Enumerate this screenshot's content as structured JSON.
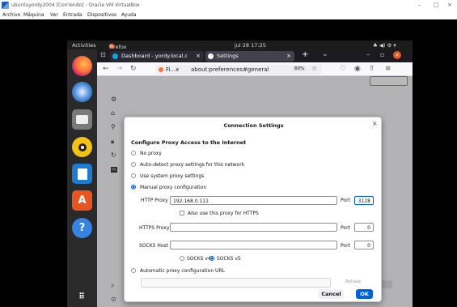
{
  "host": {
    "window_title": "ubuntuyordy2004 [Corriendo] - Oracle VM VirtualBox",
    "menu": [
      "Archivo",
      "Máquina",
      "Ver",
      "Entrada",
      "Dispositivos",
      "Ayuda"
    ],
    "controls": {
      "minimize": "–",
      "maximize": "□",
      "close": "×"
    }
  },
  "ubuntu": {
    "activities": "Activities",
    "app_name": "Firefox Web Browser ▾",
    "clock": "jul 28  17:25",
    "tray": "♣ ◀) ⚙ ▾",
    "dock_icons": [
      "firefox-icon",
      "thunderbird-icon",
      "files-icon",
      "rhythmbox-icon",
      "writer-icon",
      "software-icon",
      "help-icon",
      "apps-grid-icon"
    ]
  },
  "firefox": {
    "tabs": [
      {
        "label": "Dashboard - yordy.local.c",
        "close": "×"
      },
      {
        "label": "Settings",
        "close": "×"
      }
    ],
    "new_tab": "+",
    "list_tabs": "⌄",
    "window_min": "–",
    "window_max": "▫",
    "window_close": "×",
    "url_site": "Fi...x",
    "url": "about:preferences#general",
    "zoom": "80%"
  },
  "dialog": {
    "title": "Connection Settings",
    "close": "×",
    "heading": "Configure Proxy Access to the Internet",
    "options": {
      "no_proxy": "No proxy",
      "auto_detect": "Auto-detect proxy settings for this network",
      "system": "Use system proxy settings",
      "manual": "Manual proxy configuration",
      "auto_url": "Automatic proxy configuration URL"
    },
    "selected": "manual",
    "http_proxy_label": "HTTP Proxy",
    "http_proxy_value": "192.168.0.111",
    "http_port_label": "Port",
    "http_port_value": "3128",
    "also_https_label": "Also use this proxy for HTTPS",
    "https_proxy_label": "HTTPS Proxy",
    "https_proxy_value": "",
    "https_port_label": "Port",
    "https_port_value": "0",
    "socks_host_label": "SOCKS Host",
    "socks_host_value": "",
    "socks_port_label": "Port",
    "socks_port_value": "0",
    "socks_v4_label": "SOCKS v4",
    "socks_v5_label": "SOCKS v5",
    "socks_selected": "v5",
    "reload_label": "Reload",
    "cancel_label": "Cancel",
    "ok_label": "OK"
  }
}
